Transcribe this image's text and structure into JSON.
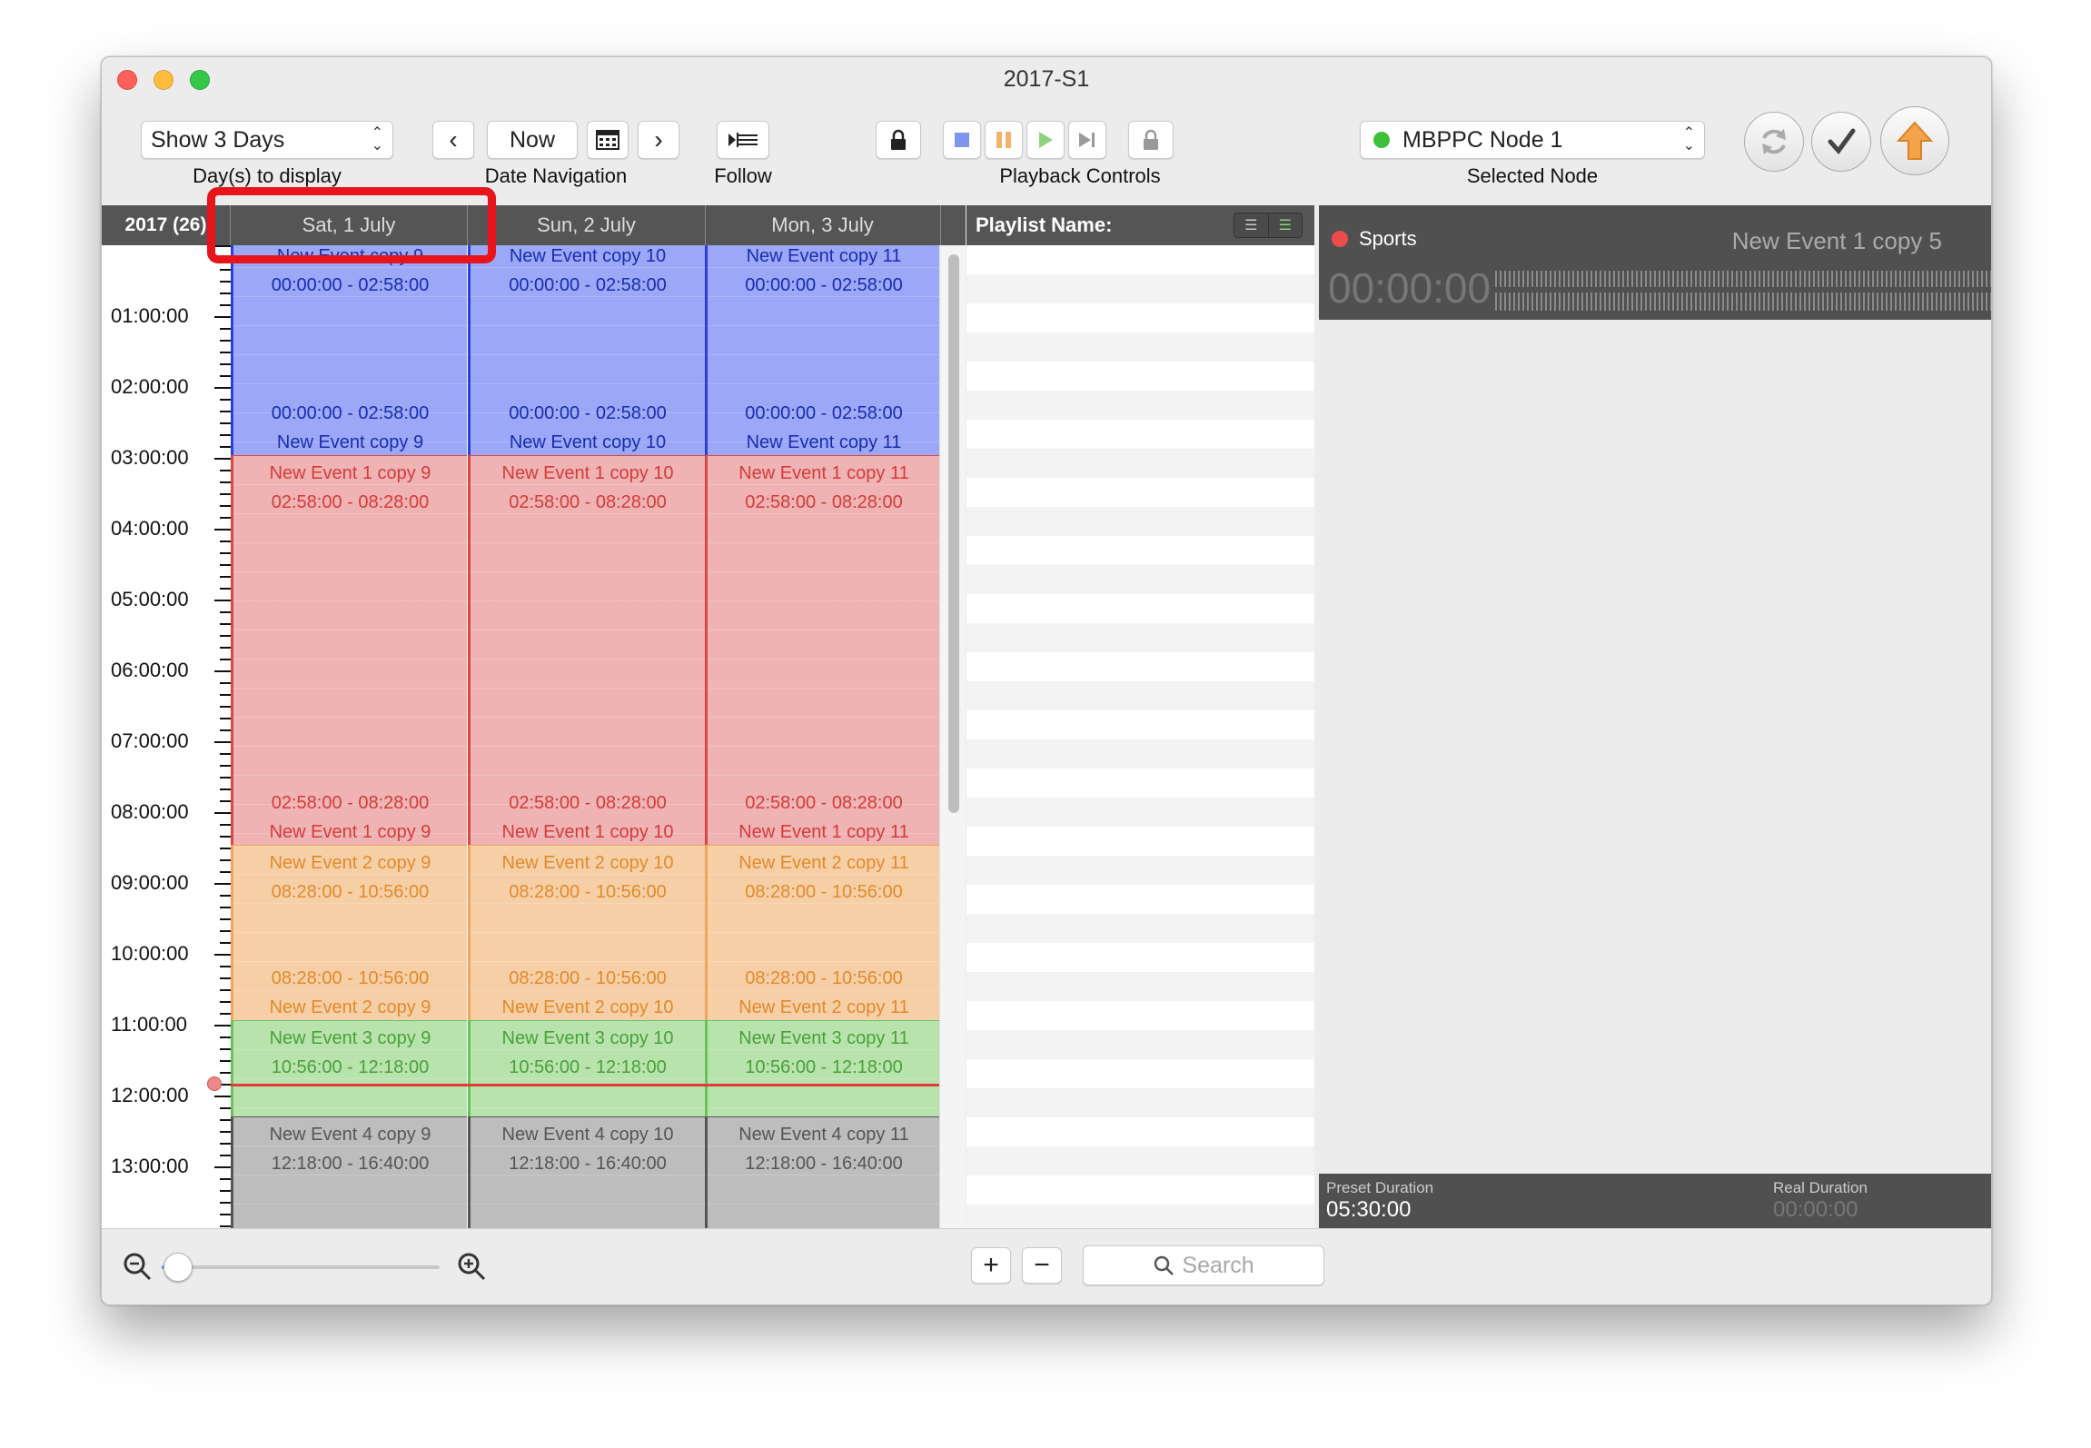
{
  "window": {
    "title": "2017-S1"
  },
  "toolbar": {
    "days_select": "Show 3 Days",
    "days_caption": "Day(s) to display",
    "now_label": "Now",
    "date_nav_caption": "Date Navigation",
    "follow_caption": "Follow",
    "playback_caption": "Playback Controls",
    "node_select": "MBPPC Node 1",
    "node_caption": "Selected Node"
  },
  "calendar": {
    "year_label": "2017 (26)",
    "days": [
      "Sat, 1 July",
      "Sun, 2 July",
      "Mon, 3 July"
    ],
    "hours": [
      "01:00:00",
      "02:00:00",
      "03:00:00",
      "04:00:00",
      "05:00:00",
      "06:00:00",
      "07:00:00",
      "08:00:00",
      "09:00:00",
      "10:00:00",
      "11:00:00",
      "12:00:00",
      "13:00:00"
    ],
    "events": [
      {
        "color": "blue",
        "days": [
          {
            "name": "New Event copy 9",
            "time": "00:00:00 - 02:58:00"
          },
          {
            "name": "New Event copy 10",
            "time": "00:00:00 - 02:58:00"
          },
          {
            "name": "New Event copy 11",
            "time": "00:00:00 - 02:58:00"
          }
        ]
      },
      {
        "color": "red",
        "days": [
          {
            "name": "New Event 1 copy 9",
            "time": "02:58:00 - 08:28:00"
          },
          {
            "name": "New Event 1 copy 10",
            "time": "02:58:00 - 08:28:00"
          },
          {
            "name": "New Event 1 copy 11",
            "time": "02:58:00 - 08:28:00"
          }
        ]
      },
      {
        "color": "orange",
        "days": [
          {
            "name": "New Event 2 copy 9",
            "time": "08:28:00 - 10:56:00"
          },
          {
            "name": "New Event 2 copy 10",
            "time": "08:28:00 - 10:56:00"
          },
          {
            "name": "New Event 2 copy 11",
            "time": "08:28:00 - 10:56:00"
          }
        ]
      },
      {
        "color": "green",
        "days": [
          {
            "name": "New Event 3 copy 9",
            "time": "10:56:00 - 12:18:00"
          },
          {
            "name": "New Event 3 copy 10",
            "time": "10:56:00 - 12:18:00"
          },
          {
            "name": "New Event 3 copy 11",
            "time": "10:56:00 - 12:18:00"
          }
        ]
      },
      {
        "color": "gray",
        "days": [
          {
            "name": "New Event 4 copy 9",
            "time": "12:18:00 - 16:40:00"
          },
          {
            "name": "New Event 4 copy 10",
            "time": "12:18:00 - 16:40:00"
          },
          {
            "name": "New Event 4 copy 11",
            "time": "12:18:00 - 16:40:00"
          }
        ]
      }
    ]
  },
  "playlist": {
    "header": "Playlist Name:",
    "search_placeholder": "Search"
  },
  "detail": {
    "channel_name": "Sports",
    "event_name": "New Event 1 copy 5",
    "timecode": "00:00:00",
    "preset_label": "Preset Duration",
    "preset_value": "05:30:00",
    "real_label": "Real Duration",
    "real_value": "00:00:00"
  },
  "colors": {
    "blue": "#9aa8f7",
    "red": "#efb3b3",
    "orange": "#f7cfa6",
    "green": "#b9e3ad",
    "gray": "#bdbdbd",
    "highlight": "#e8141c",
    "upload": "#f5a24a"
  }
}
